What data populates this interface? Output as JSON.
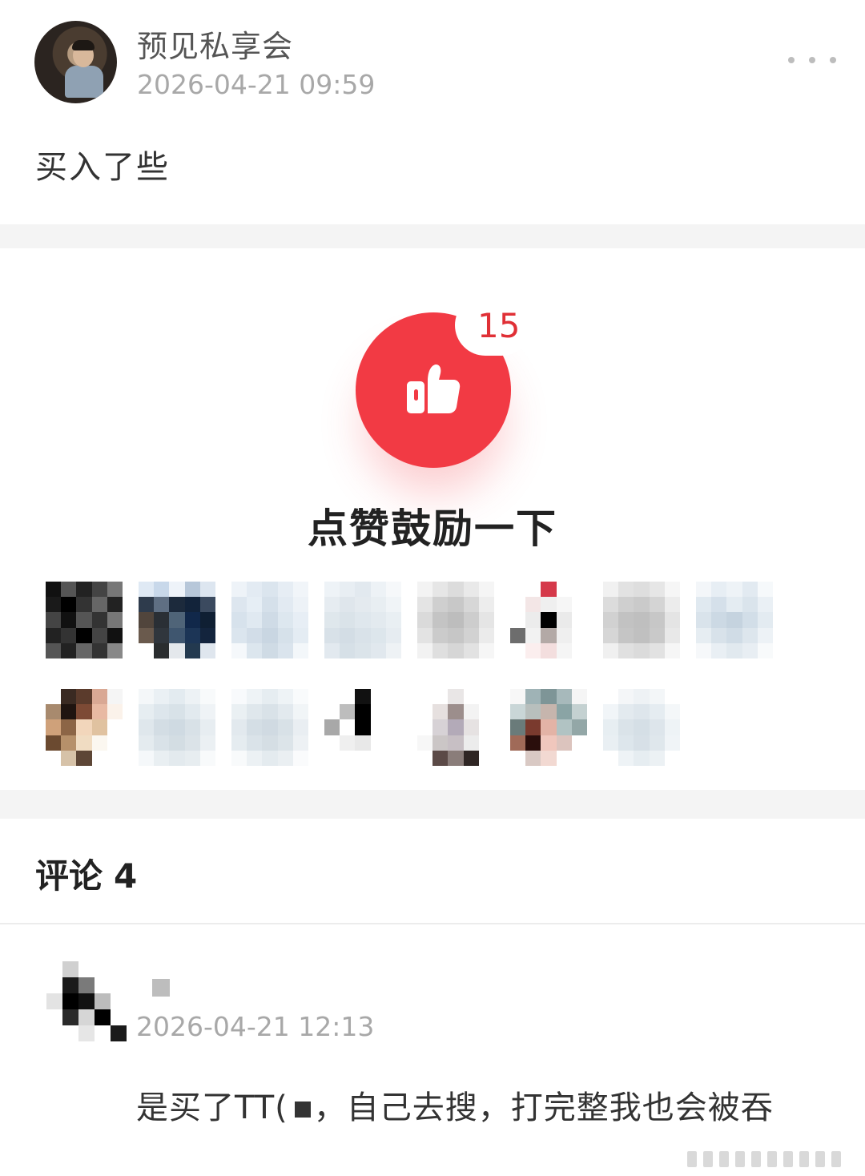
{
  "post": {
    "username": "预见私享会",
    "time": "2026-04-21 09:59",
    "text": "买入了些"
  },
  "like": {
    "count": "15",
    "label": "点赞鼓励一下",
    "accent": "#f23a44"
  },
  "likers": [
    [
      "#111",
      "#555",
      "#222",
      "#444",
      "#777",
      "#1a1a1a",
      "#000",
      "#333",
      "#666",
      "#222",
      "#444",
      "#111",
      "#555",
      "#333",
      "#777",
      "#222",
      "#333",
      "#000",
      "#444",
      "#111",
      "#555",
      "#222",
      "#666",
      "#333",
      "#888"
    ],
    [
      "#dfe9f4",
      "#c8d8ea",
      "#eef3f9",
      "#b7c7d9",
      "#dde6f0",
      "#2e3b4c",
      "#5f6f83",
      "#1c2a3c",
      "#12233a",
      "#3b4a5f",
      "#51453c",
      "#2a2f35",
      "#4f6478",
      "#11284a",
      "#0f1f33",
      "#6a5a4d",
      "#30363d",
      "#3f566f",
      "#1c3556",
      "#13243d",
      "#ffffff",
      "#2a2d2f",
      "#e4e8ec",
      "#23394f",
      "#dfe6ee"
    ],
    [
      "#eef3f8",
      "#e3ebf3",
      "#dbe5ee",
      "#e6edf4",
      "#f1f5f9",
      "#dde6ef",
      "#e6eef5",
      "#d5e0ea",
      "#e2eaf2",
      "#edf2f7",
      "#d7e2ec",
      "#e0e9f1",
      "#cfdbe6",
      "#dde7ef",
      "#e7eef5",
      "#dbe5ee",
      "#d2dde8",
      "#c9d6e2",
      "#d6e1ea",
      "#e4ecf3",
      "#f5f8fb",
      "#dce6ee",
      "#cfdbe5",
      "#dae4ed",
      "#f3f7fa"
    ],
    [
      "#eef3f7",
      "#e8eef3",
      "#e2e9ef",
      "#edf2f6",
      "#f6f8fa",
      "#e6ecf1",
      "#dfe6ec",
      "#e4eaef",
      "#e8eef2",
      "#f0f4f7",
      "#dfe7ec",
      "#dae3e9",
      "#dfe7ed",
      "#e3eaef",
      "#e9eff3",
      "#d8e1e8",
      "#d3dde5",
      "#d9e2e9",
      "#dde6ec",
      "#e6ecf1",
      "#e2e9ef",
      "#d6e0e7",
      "#dbe4ea",
      "#e1e8ee",
      "#eef2f5"
    ],
    [
      "#f3f3f3",
      "#e6e6e6",
      "#dcdcdc",
      "#e9e9e9",
      "#f5f5f5",
      "#e4e4e4",
      "#cfcfcf",
      "#c8c8c8",
      "#d7d7d7",
      "#ededed",
      "#dadada",
      "#c4c4c4",
      "#bdbdbd",
      "#cdcdcd",
      "#e5e5e5",
      "#e3e3e3",
      "#cbcbcb",
      "#c6c6c6",
      "#d2d2d2",
      "#ebebeb",
      "#f2f2f2",
      "#dfdfdf",
      "#d6d6d6",
      "#e2e2e2",
      "#f6f6f6"
    ],
    [
      "#ffffff",
      "#ffffff",
      "#d5394a",
      "#ffffff",
      "#ffffff",
      "#ffffff",
      "#f3e6e6",
      "#efefef",
      "#f6f6f6",
      "#ffffff",
      "#ffffff",
      "#ececec",
      "#000000",
      "#eaeaea",
      "#ffffff",
      "#6d6d6d",
      "#f2f2f2",
      "#b3a9a6",
      "#efefef",
      "#ffffff",
      "#ffffff",
      "#fbeeee",
      "#f3dede",
      "#f5f5f5",
      "#ffffff"
    ],
    [
      "#f1f1f1",
      "#e2e2e2",
      "#dedede",
      "#e6e6e6",
      "#f6f6f6",
      "#dcdcdc",
      "#cfcfcf",
      "#cacaca",
      "#d4d4d4",
      "#ececec",
      "#d1d1d1",
      "#c2c2c2",
      "#bfbfbf",
      "#c7c7c7",
      "#e4e4e4",
      "#d6d6d6",
      "#c5c5c5",
      "#c0c0c0",
      "#c9c9c9",
      "#e8e8e8",
      "#f0f0f0",
      "#e0e0e0",
      "#dbdbdb",
      "#e2e2e2",
      "#f6f6f6"
    ],
    [
      "#f3f6f9",
      "#e7eef4",
      "#eef3f7",
      "#e2eaf1",
      "#f6f9fb",
      "#e0e9f0",
      "#d5e0ea",
      "#e4ecf2",
      "#dae4ec",
      "#eaf0f5",
      "#d9e3eb",
      "#ccd9e4",
      "#c5d3df",
      "#d2dee8",
      "#e3ebf1",
      "#e6edf2",
      "#d8e2ea",
      "#d0dce6",
      "#dde6ed",
      "#edf2f6",
      "#f6f8fa",
      "#e9eff4",
      "#e1e9ef",
      "#e8eef3",
      "#f8fafb"
    ],
    [
      "#ffffff",
      "#3a2a22",
      "#5b3b2c",
      "#d9a894",
      "#f5f5f5",
      "#a88a6e",
      "#1f1410",
      "#7d4a35",
      "#e8b9a3",
      "#fbf2ea",
      "#cfa17a",
      "#8c6546",
      "#f2d6bb",
      "#e0c2a0",
      "#ffffff",
      "#6b4a30",
      "#b6906a",
      "#f0dcc2",
      "#fbf7f0",
      "#ffffff",
      "#ffffff",
      "#d6c2a8",
      "#5d4636",
      "#ffffff",
      "#ffffff"
    ],
    [
      "#f4f7f9",
      "#eaf0f4",
      "#e3ebf0",
      "#edf2f5",
      "#f8fafb",
      "#e6edf1",
      "#dde6ec",
      "#d8e2e8",
      "#e2eaef",
      "#eff3f6",
      "#dfe7ec",
      "#d3dde4",
      "#cfdae2",
      "#d8e1e7",
      "#e7edf1",
      "#e4ebef",
      "#d9e2e8",
      "#d3dde3",
      "#dbe3e8",
      "#ebf0f3",
      "#f5f8fa",
      "#e9eff2",
      "#e3eaee",
      "#e7edf0",
      "#f8fafb"
    ],
    [
      "#f8fafc",
      "#eef3f6",
      "#e6edf1",
      "#eef3f6",
      "#f9fbfc",
      "#eaf0f3",
      "#dfe7ec",
      "#d9e2e8",
      "#e2e9ee",
      "#f1f5f7",
      "#e2e9ee",
      "#d4dee5",
      "#d0dae2",
      "#d8e1e7",
      "#e9eef2",
      "#e5ecf0",
      "#dae3e9",
      "#d5dee4",
      "#dce4e9",
      "#edf1f4",
      "#f8fafb",
      "#ecf1f4",
      "#e4ebef",
      "#eaeff2",
      "#fafbfc"
    ],
    [
      "#ffffff",
      "#ffffff",
      "#111111",
      "#ffffff",
      "#ffffff",
      "#ffffff",
      "#bdbdbd",
      "#000000",
      "#ffffff",
      "#ffffff",
      "#a8a8a8",
      "#ffffff",
      "#000000",
      "#ffffff",
      "#ffffff",
      "#ffffff",
      "#efefef",
      "#e8e8e8",
      "#ffffff",
      "#ffffff",
      "#ffffff",
      "#ffffff",
      "#ffffff",
      "#ffffff",
      "#ffffff"
    ],
    [
      "#ffffff",
      "#ffffff",
      "#e9e6e6",
      "#ffffff",
      "#ffffff",
      "#ffffff",
      "#e6e0df",
      "#9c8e8c",
      "#f3f3f3",
      "#ffffff",
      "#ffffff",
      "#d7d2d6",
      "#b3aab8",
      "#e6e2e2",
      "#ffffff",
      "#f7f7f7",
      "#cbc6c6",
      "#c7bfc4",
      "#ececec",
      "#ffffff",
      "#ffffff",
      "#5b4a47",
      "#8a7d7a",
      "#2f2624",
      "#ffffff"
    ],
    [
      "#f7f7f7",
      "#9fb3b6",
      "#7e9597",
      "#a7b9bb",
      "#f5f5f5",
      "#c9d6d7",
      "#b8bfbd",
      "#c6b5ad",
      "#8aa4a5",
      "#c4d1d1",
      "#6a7b7a",
      "#7a3a2e",
      "#e3b3a6",
      "#b1c3c3",
      "#93a7a7",
      "#a06a58",
      "#2a0e0c",
      "#f0c7bd",
      "#dcc4be",
      "#ffffff",
      "#ffffff",
      "#d9c9c4",
      "#f2d9d2",
      "#ffffff",
      "#ffffff"
    ],
    [
      "#ffffff",
      "#f4f6f8",
      "#eef2f5",
      "#f3f6f8",
      "#ffffff",
      "#f1f5f8",
      "#e3eaef",
      "#dee6ec",
      "#e5ecf1",
      "#f4f7f9",
      "#e7eef2",
      "#dae3e9",
      "#d5dfe6",
      "#dde5eb",
      "#eef3f6",
      "#e9eff3",
      "#dde6ec",
      "#d7e0e7",
      "#dfe7ec",
      "#f0f4f7",
      "#ffffff",
      "#eef3f6",
      "#e6edf1",
      "#ecf1f4",
      "#ffffff"
    ]
  ],
  "comments": {
    "label": "评论",
    "count": "4",
    "items": [
      {
        "avatar": [
          "#ffffff",
          "#d0d0d0",
          "#ffffff",
          "#ffffff",
          "#ffffff",
          "#ffffff",
          "#1a1a1a",
          "#7a7a7a",
          "#ffffff",
          "#ffffff",
          "#e3e3e3",
          "#000000",
          "#111111",
          "#bcbcbc",
          "#ffffff",
          "#ffffff",
          "#2a2a2a",
          "#d6d6d6",
          "#000000",
          "#ffffff",
          "#ffffff",
          "#ffffff",
          "#e6e6e6",
          "#ffffff",
          "#1a1a1a"
        ],
        "time": "2026-04-21 12:13",
        "text_before": "是买了TT(",
        "text_after": "，自己去搜，打完整我也会被吞"
      }
    ]
  }
}
